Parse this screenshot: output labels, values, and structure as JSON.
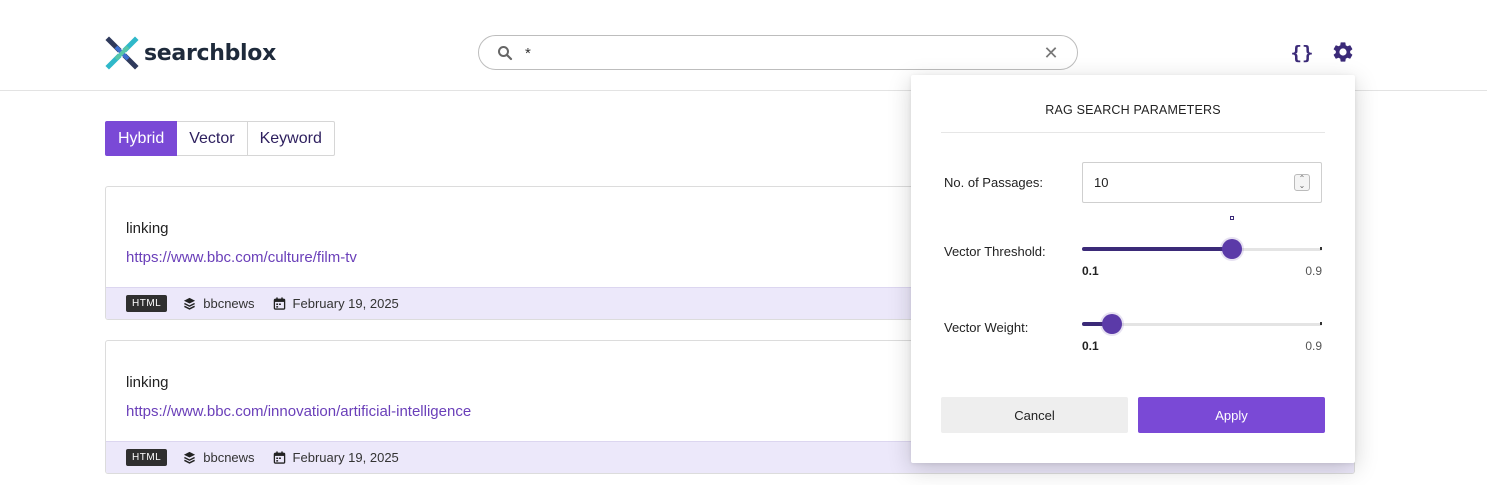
{
  "header": {
    "logo_text": "searchblox",
    "search_value": "*",
    "json_button": "{}"
  },
  "tabs": [
    {
      "label": "Hybrid",
      "active": true
    },
    {
      "label": "Vector",
      "active": false
    },
    {
      "label": "Keyword",
      "active": false
    }
  ],
  "results": [
    {
      "title": "linking",
      "url": "https://www.bbc.com/culture/film-tv",
      "type": "HTML",
      "collection": "bbcnews",
      "date": "February 19, 2025"
    },
    {
      "title": "linking",
      "url": "https://www.bbc.com/innovation/artificial-intelligence",
      "type": "HTML",
      "collection": "bbcnews",
      "date": "February 19, 2025"
    }
  ],
  "rag_panel": {
    "title": "RAG SEARCH PARAMETERS",
    "passages_label": "No. of Passages:",
    "passages_value": "10",
    "vector_threshold": {
      "label": "Vector Threshold:",
      "value_fraction": 0.625,
      "min_label": "0.1",
      "max_label": "0.9"
    },
    "vector_weight": {
      "label": "Vector Weight:",
      "value_fraction": 0.125,
      "min_label": "0.1",
      "max_label": "0.9"
    },
    "cancel_label": "Cancel",
    "apply_label": "Apply"
  },
  "colors": {
    "accent": "#7a49d6",
    "dark_accent": "#3b2a78",
    "meta_bg": "#ece8fa",
    "link": "#6a3fb9"
  }
}
